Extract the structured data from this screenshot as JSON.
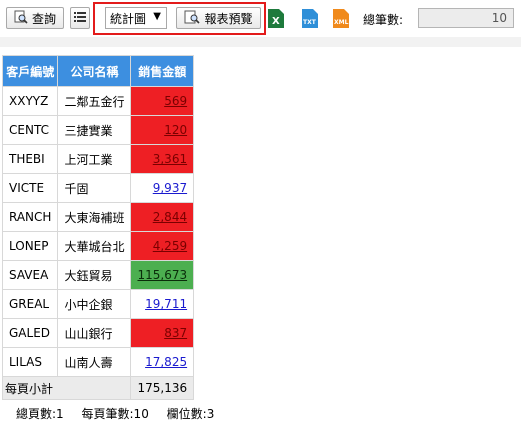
{
  "toolbar": {
    "query_label": "查詢",
    "chart_select_value": "統計圖",
    "preview_label": "報表預覽",
    "excel_tag": "X",
    "txt_tag": "TXT",
    "xml_tag": "XML",
    "total_label": "總筆數:",
    "total_value": "10"
  },
  "table": {
    "headers": [
      "客戶編號",
      "公司名稱",
      "銷售金額"
    ],
    "rows": [
      {
        "id": "XXYYZ",
        "name": "二鄰五金行",
        "amount": "569",
        "status": "red"
      },
      {
        "id": "CENTC",
        "name": "三捷實業",
        "amount": "120",
        "status": "red"
      },
      {
        "id": "THEBI",
        "name": "上河工業",
        "amount": "3,361",
        "status": "red"
      },
      {
        "id": "VICTE",
        "name": "千固",
        "amount": "9,937",
        "status": "normal"
      },
      {
        "id": "RANCH",
        "name": "大東海補班",
        "amount": "2,844",
        "status": "red"
      },
      {
        "id": "LONEP",
        "name": "大華城台北",
        "amount": "4,259",
        "status": "red"
      },
      {
        "id": "SAVEA",
        "name": "大鈺貿易",
        "amount": "115,673",
        "status": "green"
      },
      {
        "id": "GREAL",
        "name": "小中企銀",
        "amount": "19,711",
        "status": "normal"
      },
      {
        "id": "GALED",
        "name": "山山銀行",
        "amount": "837",
        "status": "red"
      },
      {
        "id": "LILAS",
        "name": "山南人壽",
        "amount": "17,825",
        "status": "normal"
      }
    ],
    "subtotal_label": "每頁小計",
    "subtotal_value": "175,136"
  },
  "footer": {
    "total_pages": "總頁數:1",
    "page_size": "每頁筆數:10",
    "column_count": "欄位數:3"
  },
  "colors": {
    "header_bg": "#3d8fe0",
    "red": "#ee1f24",
    "green": "#4caf50",
    "link": "#1a1acf",
    "highlight": "#e31b1b"
  }
}
